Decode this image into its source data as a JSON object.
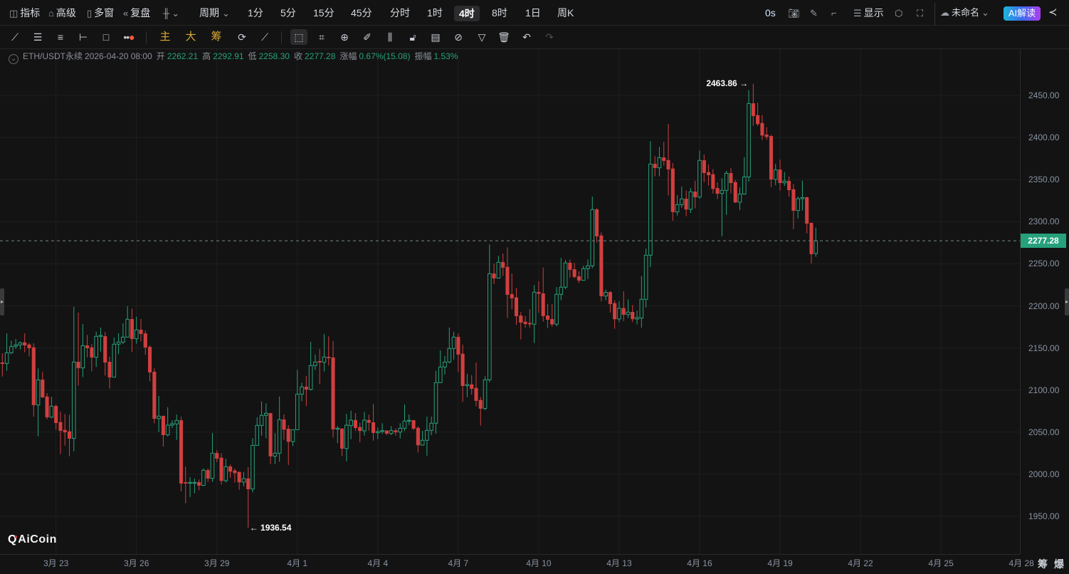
{
  "topbar": {
    "left_items": [
      {
        "icon": "indicator-icon",
        "label": "指标"
      },
      {
        "icon": "advanced-icon",
        "label": "高级"
      },
      {
        "icon": "multi-window-icon",
        "label": "多窗"
      },
      {
        "icon": "replay-icon",
        "label": "复盘"
      }
    ],
    "chart_type_icon": "candlestick-type-icon",
    "period_label": "周期",
    "intervals": [
      "1分",
      "5分",
      "15分",
      "45分",
      "分时",
      "1时",
      "4时",
      "8时",
      "1日",
      "周K"
    ],
    "active_interval": "4时",
    "timer": "0s",
    "display_label": "显示",
    "layout_name": "未命名",
    "ai_button": "AI解读"
  },
  "toolbar": {
    "gold_tools": [
      "主",
      "大",
      "筹"
    ]
  },
  "info": {
    "symbol": "ETH/USDT永续",
    "datetime": "2026-04-20 08:00",
    "open_label": "开",
    "open": "2262.21",
    "high_label": "高",
    "high": "2292.91",
    "low_label": "低",
    "low": "2258.30",
    "close_label": "收",
    "close": "2277.28",
    "change_label": "涨幅",
    "change": "0.67%(15.08)",
    "amplitude_label": "振幅",
    "amplitude": "1.53%"
  },
  "current_price": "2277.28",
  "bottom_right": {
    "chips": "筹",
    "liquidation": "爆"
  },
  "logo": "AiCoin",
  "colors": {
    "up": "#26a17b",
    "down": "#d13f3f",
    "background": "#131313",
    "grid": "#1f1f1f"
  },
  "chart_data": {
    "type": "candlestick",
    "title": "ETH/USDT永续 4时",
    "interval": "4h",
    "ylim": [
      1910,
      2490
    ],
    "yticks": [
      "2450.00",
      "2400.00",
      "2350.00",
      "2300.00",
      "2250.00",
      "2200.00",
      "2150.00",
      "2100.00",
      "2050.00",
      "2000.00",
      "1950.00"
    ],
    "xticks": [
      "3月 23",
      "3月 26",
      "3月 29",
      "4月 1",
      "4月 4",
      "4月 7",
      "4月 10",
      "4月 13",
      "4月 16",
      "4月 19",
      "4月 22",
      "4月 25",
      "4月 28"
    ],
    "xtick_first_candle": 12,
    "candles_per_xtick": 18,
    "max_label": "2463.86",
    "min_label": "1936.54",
    "last_price": 2277.28,
    "grid": true,
    "ohlc": [
      [
        2132.5,
        2143.7,
        2116.1,
        2131.3
      ],
      [
        2131.6,
        2167.1,
        2122.9,
        2144.3
      ],
      [
        2144.3,
        2158.7,
        2142.6,
        2151.6
      ],
      [
        2152,
        2160.7,
        2148.8,
        2153.6
      ],
      [
        2153.6,
        2157.8,
        2148.3,
        2156.1
      ],
      [
        2156.4,
        2167.4,
        2144.9,
        2153.3
      ],
      [
        2153.9,
        2155.9,
        2139.8,
        2149.9
      ],
      [
        2150.5,
        2155.6,
        2068.4,
        2082.3
      ],
      [
        2082.3,
        2125.7,
        2045,
        2112.1
      ],
      [
        2112.1,
        2121.7,
        2090.7,
        2091.6
      ],
      [
        2092.1,
        2096.4,
        2065.1,
        2067.9
      ],
      [
        2067.9,
        2092.1,
        2066.5,
        2080.8
      ],
      [
        2080.8,
        2082.8,
        2052.9,
        2061.1
      ],
      [
        2061.7,
        2074.4,
        2023.9,
        2051.8
      ],
      [
        2052.4,
        2071.5,
        2034,
        2050.1
      ],
      [
        2050.7,
        2070.7,
        2021.4,
        2042.5
      ],
      [
        2042.5,
        2198.7,
        2027.3,
        2133.3
      ],
      [
        2133.3,
        2192,
        2105.4,
        2126.3
      ],
      [
        2126.3,
        2178.4,
        2115.5,
        2152.8
      ],
      [
        2152.8,
        2165.5,
        2138.7,
        2150
      ],
      [
        2150.5,
        2154.7,
        2122.3,
        2138.9
      ],
      [
        2138.9,
        2169.4,
        2127.4,
        2163.8
      ],
      [
        2163.8,
        2174.2,
        2145.7,
        2164.9
      ],
      [
        2163.8,
        2169.1,
        2117.2,
        2133
      ],
      [
        2133.3,
        2139.5,
        2101.7,
        2115.3
      ],
      [
        2115.3,
        2162.4,
        2115,
        2154.5
      ],
      [
        2154.5,
        2167.4,
        2142.6,
        2157
      ],
      [
        2157,
        2179.3,
        2154.7,
        2162.9
      ],
      [
        2162.9,
        2199.6,
        2162.9,
        2184.1
      ],
      [
        2184.1,
        2196.8,
        2145.4,
        2161
      ],
      [
        2161,
        2187.2,
        2155,
        2171.4
      ],
      [
        2171.4,
        2184.4,
        2157.8,
        2166.9
      ],
      [
        2167,
        2170.8,
        2142,
        2150.8
      ],
      [
        2151,
        2153,
        2110.5,
        2121.2
      ],
      [
        2121.5,
        2125.7,
        2060.5,
        2066.2
      ],
      [
        2066.2,
        2093,
        2050.1,
        2069
      ],
      [
        2069,
        2069.9,
        2032.9,
        2046.7
      ],
      [
        2046.7,
        2079.7,
        2045,
        2058.3
      ],
      [
        2058.3,
        2064.2,
        2054.9,
        2060
      ],
      [
        2059.7,
        2071,
        2040.8,
        2063.9
      ],
      [
        2063.9,
        2068.2,
        1979.6,
        1989.2
      ],
      [
        1990.3,
        2009.2,
        1965.5,
        1989.2
      ],
      [
        1989.5,
        1996.5,
        1972.9,
        1990.3
      ],
      [
        1989.5,
        1994.9,
        1977.4,
        1990.3
      ],
      [
        1990.3,
        1993.7,
        1981,
        1986.7
      ],
      [
        1986.7,
        2007,
        1986,
        2004.7
      ],
      [
        2004.7,
        2007,
        1990.9,
        1995.1
      ],
      [
        1995.1,
        2049,
        1990.9,
        2025
      ],
      [
        2025,
        2028.4,
        2014.3,
        2018.8
      ],
      [
        2019.4,
        2025,
        1987.5,
        1992.3
      ],
      [
        1992.3,
        2018.5,
        1990.3,
        2009
      ],
      [
        2009,
        2011.5,
        1995.7,
        2003.3
      ],
      [
        2004.2,
        2006.7,
        1990,
        2001.6
      ],
      [
        2002.5,
        2003.3,
        1981.6,
        1990.6
      ],
      [
        1990.6,
        2002.7,
        1985.8,
        1994.8
      ],
      [
        1994.8,
        2008.4,
        1936.54,
        1982.4
      ],
      [
        1982.4,
        2042.8,
        1978.5,
        2034.3
      ],
      [
        2034.3,
        2067.6,
        2034.3,
        2058
      ],
      [
        2058,
        2086.5,
        2045.9,
        2069.9
      ],
      [
        2069.9,
        2084.2,
        2042.8,
        2072.4
      ],
      [
        2072.4,
        2072.4,
        2012,
        2021.4
      ],
      [
        2021.4,
        2048.7,
        2012,
        2025
      ],
      [
        2025,
        2092.4,
        2014.9,
        2064.8
      ],
      [
        2064.8,
        2071,
        2040.8,
        2053.2
      ],
      [
        2053.8,
        2058.3,
        2010.9,
        2038.8
      ],
      [
        2038.8,
        2052.9,
        2033.5,
        2052.9
      ],
      [
        2052.9,
        2124,
        2052.9,
        2095.2
      ],
      [
        2095.2,
        2108.8,
        2086.8,
        2103.7
      ],
      [
        2103.7,
        2116.7,
        2080.9,
        2100.9
      ],
      [
        2100.9,
        2157.3,
        2099.2,
        2129.1
      ],
      [
        2129.1,
        2142.3,
        2124,
        2133.3
      ],
      [
        2134.2,
        2148.8,
        2107.1,
        2133
      ],
      [
        2133,
        2166.6,
        2122,
        2139.2
      ],
      [
        2139.2,
        2163.8,
        2129.1,
        2138.1
      ],
      [
        2138.4,
        2158.1,
        2043.6,
        2053.5
      ],
      [
        2053.5,
        2057.2,
        2036.9,
        2054.6
      ],
      [
        2054.1,
        2054.1,
        2021.6,
        2030.6
      ],
      [
        2030.6,
        2071.6,
        2015.2,
        2058.3
      ],
      [
        2057.8,
        2075.5,
        2041.7,
        2064.2
      ],
      [
        2064.2,
        2072.7,
        2051.6,
        2055.2
      ],
      [
        2055.8,
        2061.4,
        2038,
        2051.6
      ],
      [
        2051.6,
        2074.1,
        2045.9,
        2064.2
      ],
      [
        2064.2,
        2070.7,
        2051.6,
        2061.4
      ],
      [
        2061.4,
        2083.7,
        2040,
        2049.3
      ],
      [
        2049.3,
        2055.5,
        2041.7,
        2050.7
      ],
      [
        2050.7,
        2060.6,
        2047.9,
        2051.8
      ],
      [
        2051.8,
        2051.8,
        2046.5,
        2048.4
      ],
      [
        2048.4,
        2057.2,
        2046.5,
        2051.8
      ],
      [
        2051.8,
        2054.4,
        2045.9,
        2050.1
      ],
      [
        2050.1,
        2060.6,
        2042.5,
        2054.6
      ],
      [
        2054.6,
        2082.8,
        2051.3,
        2063.1
      ],
      [
        2063.1,
        2071,
        2058.6,
        2064
      ],
      [
        2064,
        2064,
        2052.4,
        2054.4
      ],
      [
        2054.9,
        2056.9,
        2025.9,
        2034.6
      ],
      [
        2034.6,
        2051.6,
        2034.1,
        2040.3
      ],
      [
        2040.3,
        2068.5,
        2022,
        2052.1
      ],
      [
        2052.1,
        2068.5,
        2046.5,
        2060.6
      ],
      [
        2060.6,
        2122.9,
        2048.2,
        2108.8
      ],
      [
        2108.8,
        2147.1,
        2108.8,
        2127.4
      ],
      [
        2127.4,
        2140.4,
        2118.7,
        2133.3
      ],
      [
        2133.3,
        2174.2,
        2131.9,
        2149.4
      ],
      [
        2149.4,
        2169.1,
        2136.2,
        2162.9
      ],
      [
        2162.9,
        2167.2,
        2121.5,
        2142.4
      ],
      [
        2142.9,
        2153.9,
        2086,
        2105.1
      ],
      [
        2105.1,
        2119.2,
        2091.6,
        2106.5
      ],
      [
        2106.5,
        2117.8,
        2094.7,
        2101.7
      ],
      [
        2102.3,
        2132.8,
        2080.6,
        2087.4
      ],
      [
        2087.9,
        2091.9,
        2057.8,
        2078.1
      ],
      [
        2078.1,
        2116.4,
        2076.1,
        2112.2
      ],
      [
        2112.2,
        2272.9,
        2109.4,
        2238.2
      ],
      [
        2238.2,
        2250.4,
        2225.8,
        2232.9
      ],
      [
        2232.9,
        2259.4,
        2232.9,
        2251.8
      ],
      [
        2251.8,
        2262.2,
        2235.4,
        2245.6
      ],
      [
        2246.1,
        2269.5,
        2185.5,
        2213.4
      ],
      [
        2213.7,
        2238.5,
        2195.9,
        2209.2
      ],
      [
        2209.8,
        2221.3,
        2177.6,
        2188
      ],
      [
        2188.3,
        2192.8,
        2160.1,
        2180.4
      ],
      [
        2181,
        2188,
        2174.2,
        2178.7
      ],
      [
        2179.5,
        2196,
        2174.2,
        2178.3
      ],
      [
        2178.2,
        2224.7,
        2155.9,
        2216.3
      ],
      [
        2216.3,
        2229.2,
        2191.7,
        2214.6
      ],
      [
        2214.6,
        2245.6,
        2181.3,
        2188.1
      ],
      [
        2188.3,
        2202.4,
        2173.7,
        2183.8
      ],
      [
        2184.1,
        2201.9,
        2175.1,
        2178.2
      ],
      [
        2178.2,
        2222.2,
        2175.6,
        2213.7
      ],
      [
        2213.7,
        2256.9,
        2206.7,
        2222.2
      ],
      [
        2222.2,
        2254.6,
        2219.9,
        2251
      ],
      [
        2251,
        2255.2,
        2233.5,
        2243.1
      ],
      [
        2243.3,
        2251,
        2232.9,
        2234.6
      ],
      [
        2234.9,
        2241.1,
        2227,
        2230.3
      ],
      [
        2230.3,
        2247.6,
        2230.3,
        2244.2
      ],
      [
        2244.2,
        2255.2,
        2232,
        2247.6
      ],
      [
        2247.6,
        2329.9,
        2244.7,
        2314.4
      ],
      [
        2314.4,
        2316.1,
        2275.2,
        2282.8
      ],
      [
        2283.4,
        2287.3,
        2205.3,
        2211.7
      ],
      [
        2211.7,
        2219.4,
        2206.7,
        2216
      ],
      [
        2216.2,
        2217.4,
        2192,
        2202.4
      ],
      [
        2203,
        2206.7,
        2172.8,
        2184.4
      ],
      [
        2184.4,
        2205.5,
        2180.7,
        2197.1
      ],
      [
        2197.1,
        2217.4,
        2181.8,
        2189.7
      ],
      [
        2189.7,
        2207.5,
        2185.5,
        2192.6
      ],
      [
        2192.6,
        2201,
        2180.7,
        2184.4
      ],
      [
        2184.4,
        2194.5,
        2177.9,
        2186.1
      ],
      [
        2185.5,
        2235.4,
        2174.2,
        2207.8
      ],
      [
        2207.8,
        2268.1,
        2198.2,
        2260.2
      ],
      [
        2260.2,
        2395.6,
        2246.1,
        2368.5
      ],
      [
        2368.5,
        2377.8,
        2353.9,
        2364
      ],
      [
        2364,
        2388.8,
        2353.9,
        2376.1
      ],
      [
        2376.1,
        2395,
        2366.6,
        2372.5
      ],
      [
        2373,
        2416.2,
        2331.3,
        2362.3
      ],
      [
        2362.9,
        2369.7,
        2301.1,
        2311.6
      ],
      [
        2311.6,
        2331.6,
        2307.3,
        2320.3
      ],
      [
        2320.3,
        2341.7,
        2316.6,
        2327.1
      ],
      [
        2327.1,
        2337,
        2306.5,
        2314.7
      ],
      [
        2314.7,
        2340,
        2310.4,
        2335.5
      ],
      [
        2335.5,
        2348.5,
        2315.8,
        2329.3
      ],
      [
        2329.3,
        2384.6,
        2327.1,
        2372.8
      ],
      [
        2372.8,
        2379.8,
        2347.1,
        2358.1
      ],
      [
        2358.6,
        2367.9,
        2342.8,
        2355.5
      ],
      [
        2356.1,
        2362.5,
        2333.5,
        2339.1
      ],
      [
        2339.7,
        2346.8,
        2327,
        2333.5
      ],
      [
        2333.5,
        2351.8,
        2282.7,
        2337.2
      ],
      [
        2337.2,
        2360.3,
        2308.1,
        2357.5
      ],
      [
        2357.5,
        2363.7,
        2333.5,
        2346.2
      ],
      [
        2346.8,
        2349.6,
        2322.2,
        2323.1
      ],
      [
        2323.1,
        2340.6,
        2313.8,
        2332.9
      ],
      [
        2332.9,
        2376.6,
        2332.1,
        2353.2
      ],
      [
        2353.2,
        2456.2,
        2347.6,
        2440.4
      ],
      [
        2440.4,
        2463.86,
        2413.9,
        2425.7
      ],
      [
        2426.3,
        2441.5,
        2413.9,
        2416.1
      ],
      [
        2417,
        2426.6,
        2397,
        2402.6
      ],
      [
        2403.2,
        2412.2,
        2397.5,
        2400.9
      ],
      [
        2401.5,
        2403.4,
        2341.1,
        2350.4
      ],
      [
        2350.4,
        2368.8,
        2343.4,
        2361.7
      ],
      [
        2361.7,
        2373.8,
        2336.9,
        2346.2
      ],
      [
        2346.2,
        2358.9,
        2342.5,
        2348.2
      ],
      [
        2348.2,
        2353.8,
        2329.8,
        2337.7
      ],
      [
        2338.3,
        2344.8,
        2291.2,
        2313.2
      ],
      [
        2313.2,
        2329.8,
        2303.9,
        2327.3
      ],
      [
        2327.3,
        2348.7,
        2313.2,
        2328.7
      ],
      [
        2328.7,
        2329.8,
        2286.1,
        2298
      ],
      [
        2298.5,
        2298.5,
        2250.3,
        2261.6
      ],
      [
        2262.21,
        2292.91,
        2258.3,
        2277.28
      ]
    ]
  }
}
